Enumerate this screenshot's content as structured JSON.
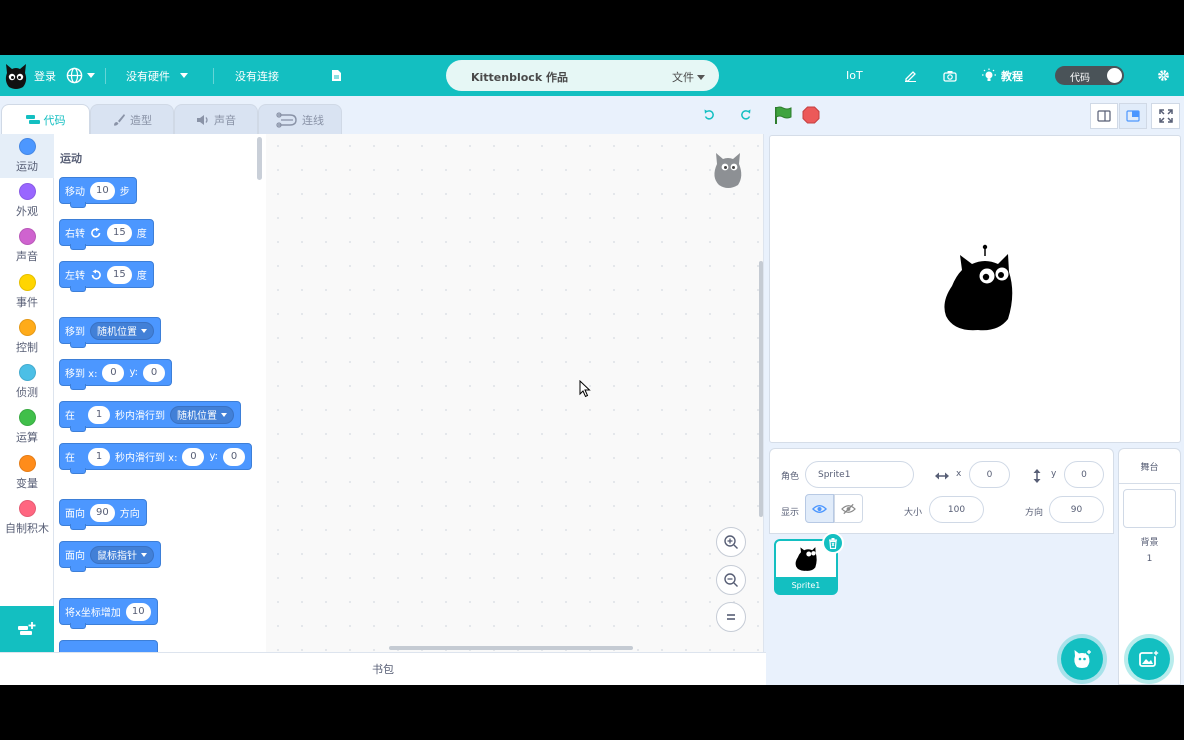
{
  "menubar": {
    "login": "登录",
    "hardware": "没有硬件",
    "connection": "没有连接",
    "project_title": "Kittenblock 作品",
    "file_menu": "文件",
    "iot": "IoT",
    "tutorial": "教程",
    "code_toggle": "代码"
  },
  "tabs": [
    {
      "label": "代码"
    },
    {
      "label": "造型"
    },
    {
      "label": "声音"
    },
    {
      "label": "连线"
    }
  ],
  "categories": [
    {
      "label": "运动",
      "color": "#4c97ff"
    },
    {
      "label": "外观",
      "color": "#9966ff"
    },
    {
      "label": "声音",
      "color": "#cf63cf"
    },
    {
      "label": "事件",
      "color": "#ffd500"
    },
    {
      "label": "控制",
      "color": "#ffab19"
    },
    {
      "label": "侦测",
      "color": "#4cbfe6"
    },
    {
      "label": "运算",
      "color": "#40bf4a"
    },
    {
      "label": "变量",
      "color": "#ff8c1a"
    },
    {
      "label": "自制积木",
      "color": "#ff6680"
    }
  ],
  "palette": {
    "section_title": "运动",
    "blocks": {
      "move": {
        "label": "移动",
        "value": "10",
        "suffix": "步"
      },
      "turn_right": {
        "label": "右转",
        "value": "15",
        "suffix": "度"
      },
      "turn_left": {
        "label": "左转",
        "value": "15",
        "suffix": "度"
      },
      "goto": {
        "label": "移到",
        "option": "随机位置"
      },
      "goto_xy": {
        "label": "移到 x:",
        "x": "0",
        "ylabel": "y:",
        "y": "0"
      },
      "glide": {
        "prefix": "在",
        "secs": "1",
        "label": "秒内滑行到",
        "option": "随机位置"
      },
      "glide_xy": {
        "prefix": "在",
        "secs": "1",
        "label": "秒内滑行到 x:",
        "x": "0",
        "ylabel": "y:",
        "y": "0"
      },
      "point_dir": {
        "label": "面向",
        "value": "90",
        "suffix": "方向"
      },
      "point_towards": {
        "label": "面向",
        "option": "鼠标指针"
      },
      "change_x": {
        "label": "将x坐标增加",
        "value": "10"
      }
    }
  },
  "backpack": {
    "label": "书包"
  },
  "sprite_info": {
    "sprite_label": "角色",
    "sprite_name": "Sprite1",
    "x_label": "x",
    "x_value": "0",
    "y_label": "y",
    "y_value": "0",
    "show_label": "显示",
    "size_label": "大小",
    "size_value": "100",
    "direction_label": "方向",
    "direction_value": "90"
  },
  "sprites": [
    {
      "name": "Sprite1"
    }
  ],
  "stage_panel": {
    "title": "舞台",
    "backdrop_label": "背景",
    "backdrop_count": "1"
  },
  "colors": {
    "accent": "#13bfc1",
    "motion": "#4c97ff",
    "green_flag": "#3fa33f",
    "stop": "#ec5959"
  }
}
